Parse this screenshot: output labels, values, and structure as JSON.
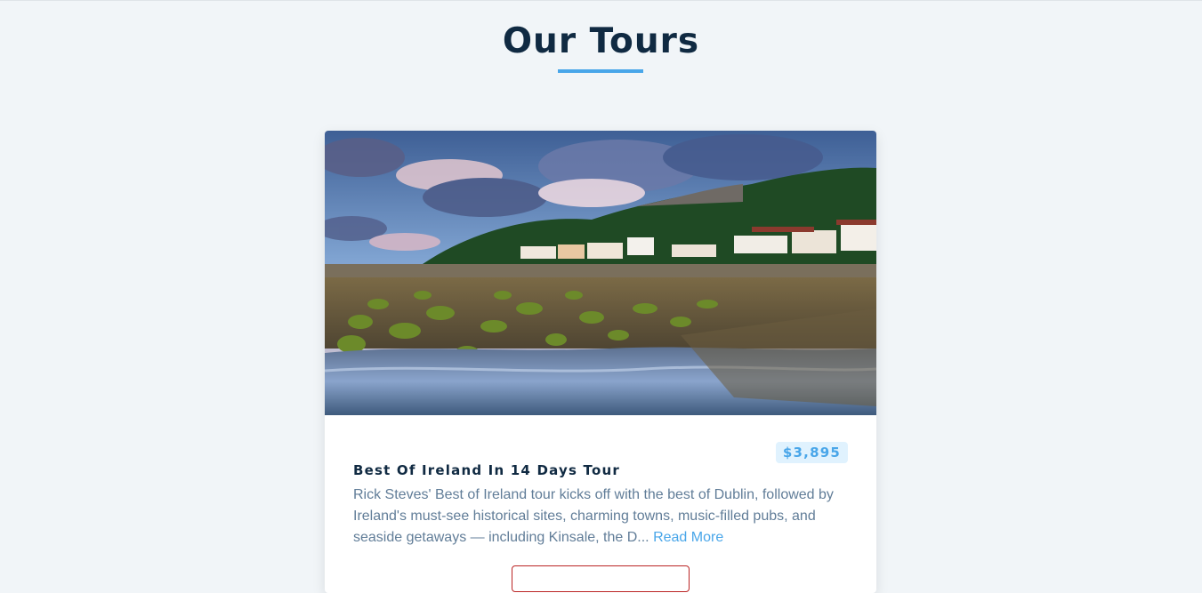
{
  "page": {
    "title": "Our Tours"
  },
  "tour": {
    "name": "Best Of Ireland In 14 Days Tour",
    "price": "$3,895",
    "description": "Rick Steves' Best of Ireland tour kicks off with the best of Dublin, followed by Ireland's must-see historical sites, charming towns, music-filled pubs, and seaside getaways — including Kinsale, the D...",
    "read_more": "Read More",
    "image_alt": "coastal village with mossy rocks"
  },
  "colors": {
    "background": "#f1f5f8",
    "title": "#102a42",
    "accent": "#49a6e9",
    "text": "#617d98",
    "danger": "#bb2525"
  }
}
